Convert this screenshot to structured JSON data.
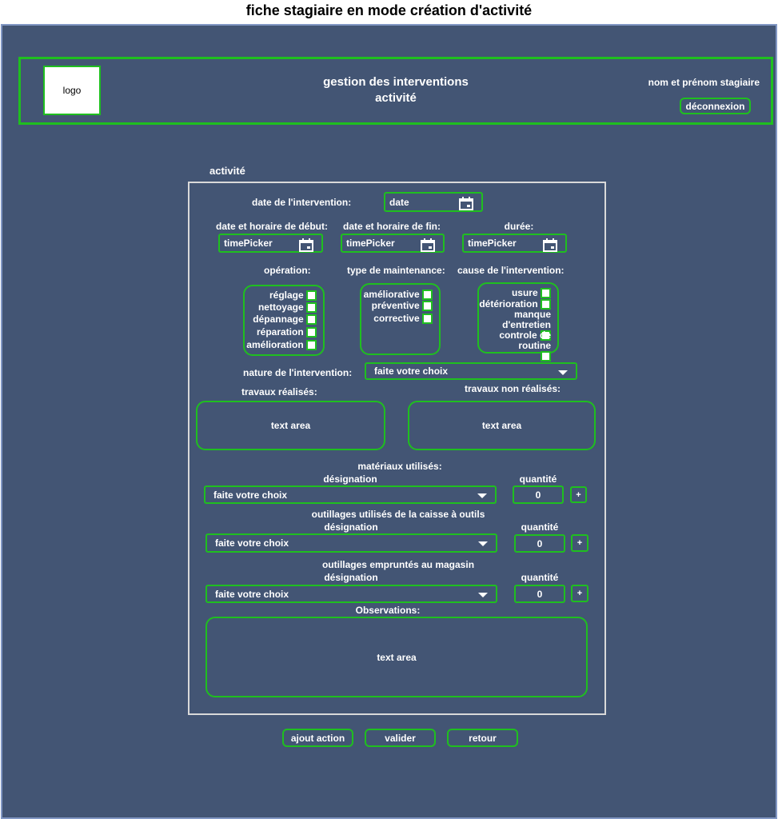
{
  "page_title": "fiche stagiaire en mode création d'activité",
  "header": {
    "logo": "logo",
    "title_line1": "gestion des interventions",
    "title_line2": "activité",
    "user_name": "nom et prénom stagiaire",
    "logout_label": "déconnexion"
  },
  "section_title": "activité",
  "form": {
    "date_label": "date de l'intervention:",
    "date_value": "date",
    "start_label": "date et horaire de début:",
    "start_value": "timePicker",
    "end_label": "date et horaire de fin:",
    "end_value": "timePicker",
    "duration_label": "durée:",
    "duration_value": "timePicker",
    "operation": {
      "label": "opération:",
      "items": [
        "réglage",
        "nettoyage",
        "dépannage",
        "réparation",
        "amélioration"
      ]
    },
    "maintenance": {
      "label": "type de maintenance:",
      "items": [
        "améliorative",
        "préventive",
        "corrective"
      ]
    },
    "cause": {
      "label": "cause de l'intervention:",
      "items": [
        "usure",
        "détérioration",
        "manque d'entretien",
        "controle de routine"
      ]
    },
    "nature_label": "nature de l'intervention:",
    "nature_value": "faite votre choix",
    "done_label": "travaux réalisés:",
    "done_value": "text area",
    "notdone_label": "travaux non réalisés:",
    "notdone_value": "text area",
    "materials": {
      "title": "matériaux utilisés:",
      "designation_label": "désignation",
      "designation_value": "faite votre choix",
      "qty_label": "quantité",
      "qty_value": "0",
      "plus": "+"
    },
    "toolbox": {
      "title": "outillages utilisés de la caisse à outils",
      "designation_label": "désignation",
      "designation_value": "faite votre choix",
      "qty_label": "quantité",
      "qty_value": "0",
      "plus": "+"
    },
    "store": {
      "title": "outillages empruntés au magasin",
      "designation_label": "désignation",
      "designation_value": "faite votre choix",
      "qty_label": "quantité",
      "qty_value": "0",
      "plus": "+"
    },
    "observations_label": "Observations:",
    "observations_value": "text area"
  },
  "footer": {
    "add_action": "ajout action",
    "validate": "valider",
    "back": "retour"
  },
  "colors": {
    "background": "#435574",
    "accent": "#1fbf1f",
    "panel_border": "#d9d9d9"
  }
}
